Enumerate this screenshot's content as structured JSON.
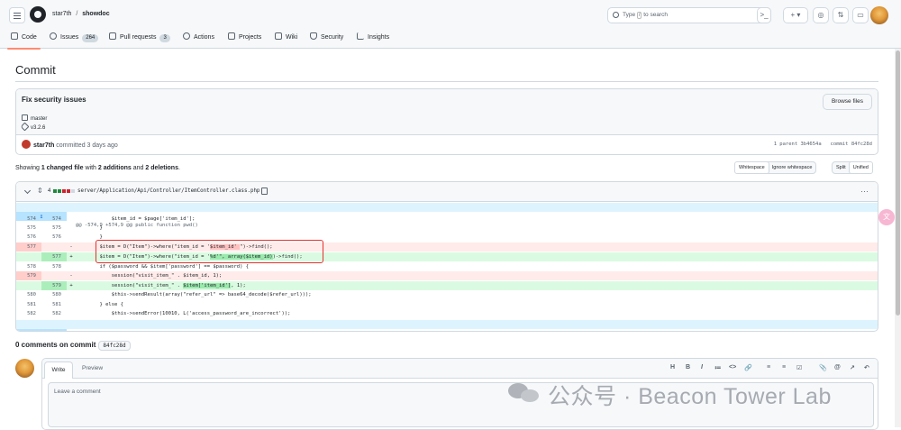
{
  "header": {
    "owner": "star7th",
    "separator": "/",
    "repo": "showdoc",
    "search_placeholder_pre": "Type",
    "search_key": "/",
    "search_placeholder_post": "to search",
    "cmd_label": ">_",
    "plus_label": "+ ▾"
  },
  "tabs": [
    {
      "label": "Code",
      "icon": "code-icon"
    },
    {
      "label": "Issues",
      "count": "264",
      "icon": "issue-icon"
    },
    {
      "label": "Pull requests",
      "count": "3",
      "icon": "pull-request-icon"
    },
    {
      "label": "Actions",
      "icon": "play-icon"
    },
    {
      "label": "Projects",
      "icon": "table-icon"
    },
    {
      "label": "Wiki",
      "icon": "book-icon"
    },
    {
      "label": "Security",
      "icon": "shield-icon"
    },
    {
      "label": "Insights",
      "icon": "graph-icon"
    }
  ],
  "page_title": "Commit",
  "commit": {
    "title": "Fix security issues",
    "browse_label": "Browse files",
    "branch": "master",
    "tag": "v3.2.6",
    "author": "star7th",
    "author_action": "committed",
    "time": "3 days ago",
    "parent_label": "1 parent",
    "parent_sha": "3b4654a",
    "commit_label": "commit",
    "commit_sha": "84fc28d"
  },
  "summary": {
    "prefix": "Showing",
    "files": "1 changed file",
    "with": "with",
    "additions": "2 additions",
    "and": "and",
    "deletions": "2 deletions",
    "end": "."
  },
  "view_options": {
    "whitespace": "Whitespace",
    "ignore_whitespace": "Ignore whitespace",
    "split": "Split",
    "unified": "Unified"
  },
  "diff": {
    "count": "4",
    "path": "server/Application/Api/Controller/ItemController.class.php",
    "hunk": "@@ -574,9 +574,9 @@ public function pwd()",
    "expand_up": "↥",
    "expand_down": "↧",
    "lines": [
      {
        "type": "ctx",
        "old": "574",
        "new": "574",
        "sign": "",
        "code": "            $item_id = $page['item_id'];"
      },
      {
        "type": "ctx",
        "old": "575",
        "new": "575",
        "sign": "",
        "code": "        }"
      },
      {
        "type": "ctx",
        "old": "576",
        "new": "576",
        "sign": "",
        "code": "        }"
      },
      {
        "type": "del",
        "old": "577",
        "new": "",
        "sign": "-",
        "code": "        $item = D(\"Item\")->where(\"item_id = '$item_id' \")->find();"
      },
      {
        "type": "add",
        "old": "",
        "new": "577",
        "sign": "+",
        "code": "        $item = D(\"Item\")->where(\"item_id = '%d'\", array($item_id))->find();"
      },
      {
        "type": "ctx",
        "old": "578",
        "new": "578",
        "sign": "",
        "code": "        if ($password && $item['password'] == $password) {"
      },
      {
        "type": "del",
        "old": "579",
        "new": "",
        "sign": "-",
        "code": "            session(\"visit_item_\" . $item_id, 1);"
      },
      {
        "type": "add",
        "old": "",
        "new": "579",
        "sign": "+",
        "code": "            session(\"visit_item_\" . $item['item_id'], 1);"
      },
      {
        "type": "ctx",
        "old": "580",
        "new": "580",
        "sign": "",
        "code": "            $this->sendResult(array(\"refer_url\" => base64_decode($refer_url)));"
      },
      {
        "type": "ctx",
        "old": "581",
        "new": "581",
        "sign": "",
        "code": "        } else {"
      },
      {
        "type": "ctx",
        "old": "582",
        "new": "582",
        "sign": "",
        "code": "            $this->sendError(10010, L('access_password_are_incorrect'));"
      }
    ]
  },
  "comments": {
    "label": "0 comments on commit",
    "sha": "84fc28d",
    "write_tab": "Write",
    "preview_tab": "Preview",
    "placeholder": "Leave a comment",
    "toolbar": [
      "H",
      "B",
      "I",
      "≔",
      "<>",
      "🔗",
      "≡",
      "≡",
      "☑",
      "📎",
      "@",
      "↗",
      "↶"
    ]
  },
  "watermark": {
    "text": "公众号 · Beacon Tower Lab"
  },
  "colors": {
    "accent_underline": "#fd8c73",
    "added_bg": "#dafbe1",
    "deleted_bg": "#ffebe9",
    "hunk_bg": "#ddf4ff",
    "highlight_box": "#e5322d"
  }
}
